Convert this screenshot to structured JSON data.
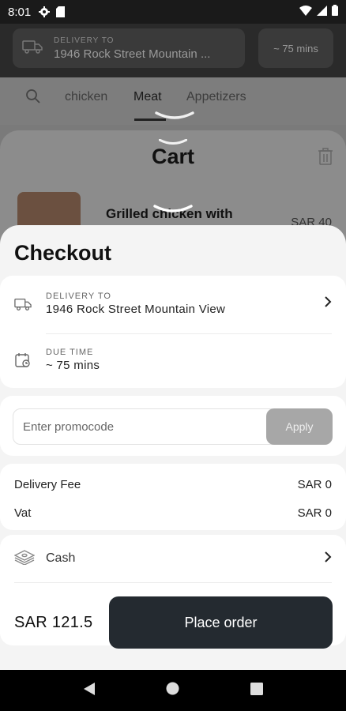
{
  "status_bar": {
    "time": "8:01"
  },
  "background": {
    "delivery_label": "DELIVERY TO",
    "delivery_address": "1946 Rock Street Mountain ...",
    "time_chip": "~ 75 mins",
    "tabs": [
      "chicken",
      "Meat",
      "Appetizers"
    ],
    "cart": {
      "title": "Cart",
      "item_name": "Grilled chicken with",
      "item_price": "SAR 40"
    }
  },
  "checkout": {
    "title": "Checkout",
    "delivery_label": "DELIVERY TO",
    "delivery_address": "1946 Rock Street Mountain View",
    "due_label": "DUE TIME",
    "due_value": "~ 75 mins",
    "promo_placeholder": "Enter promocode",
    "apply_label": "Apply",
    "fees": [
      {
        "label": "Delivery Fee",
        "value": "SAR 0"
      },
      {
        "label": "Vat",
        "value": "SAR 0"
      }
    ],
    "payment_method": "Cash",
    "total": "SAR 121.5",
    "place_order_label": "Place order"
  },
  "colors": {
    "primary_button": "#242a30",
    "apply_button": "#a7a7a7",
    "sheet_bg": "#f4f4f4"
  }
}
